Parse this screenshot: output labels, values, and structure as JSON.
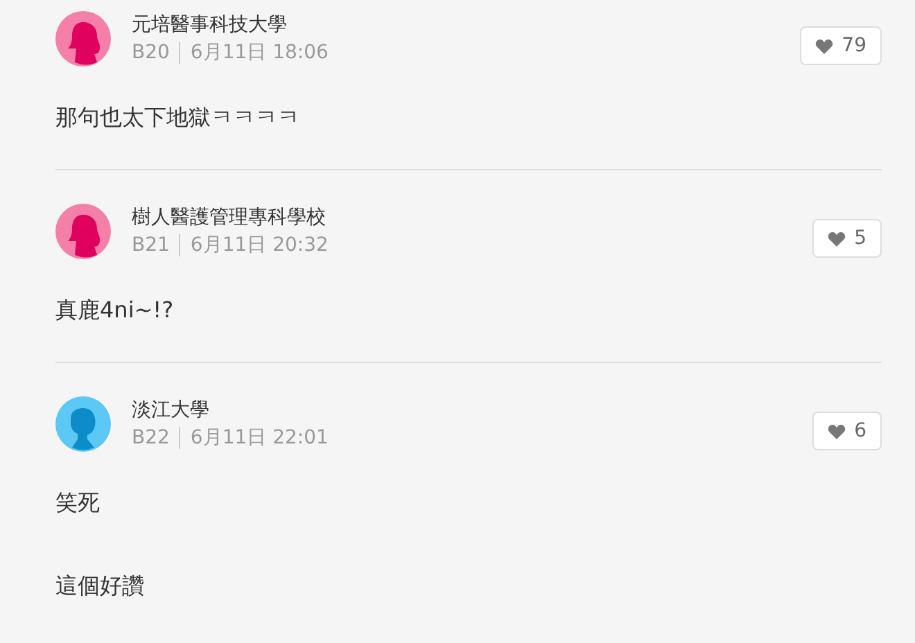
{
  "comments": [
    {
      "avatar": {
        "kind": "female"
      },
      "school": "元培醫事科技大學",
      "floor": "B20",
      "time": "6月11日 18:06",
      "likes": "79",
      "paragraphs": [
        "那句也太下地獄ㅋㅋㅋㅋ"
      ]
    },
    {
      "avatar": {
        "kind": "female"
      },
      "school": "樹人醫護管理專科學校",
      "floor": "B21",
      "time": "6月11日 20:32",
      "likes": "5",
      "paragraphs": [
        "真鹿4ni~!?"
      ]
    },
    {
      "avatar": {
        "kind": "male"
      },
      "school": "淡江大學",
      "floor": "B22",
      "time": "6月11日 22:01",
      "likes": "6",
      "paragraphs": [
        "笑死",
        "這個好讚"
      ]
    }
  ]
}
